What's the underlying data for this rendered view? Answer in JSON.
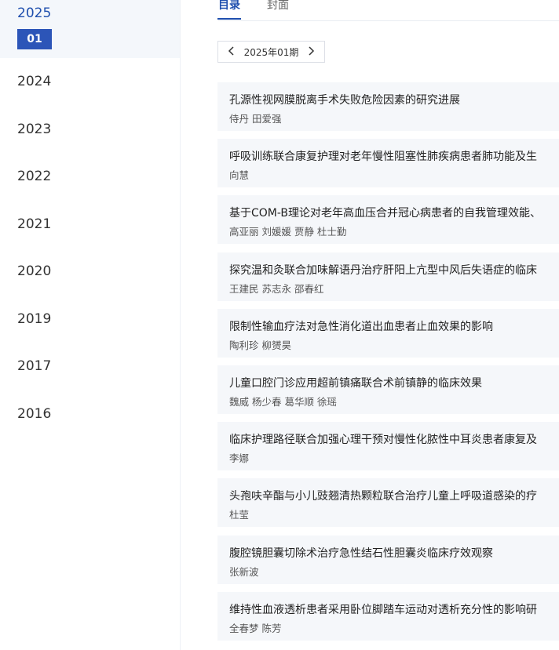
{
  "sidebar": {
    "current_year": "2025",
    "current_month": "01",
    "years": [
      "2024",
      "2023",
      "2022",
      "2021",
      "2020",
      "2019",
      "2017",
      "2016"
    ]
  },
  "tabs": [
    {
      "label": "目录",
      "active": true
    },
    {
      "label": "封面",
      "active": false
    }
  ],
  "issue_selector": {
    "label": "2025年01期",
    "prev_icon": "chevron-left-icon",
    "next_icon": "chevron-right-icon"
  },
  "articles": [
    {
      "title": "孔源性视网膜脱离手术失败危险因素的研究进展",
      "authors": "侍丹 田爱强"
    },
    {
      "title": "呼吸训练联合康复护理对老年慢性阻塞性肺疾病患者肺功能及生",
      "authors": "向慧"
    },
    {
      "title": "基于COM-B理论对老年高血压合并冠心病患者的自我管理效能、",
      "authors": "高亚丽 刘媛媛 贾静 杜士勤"
    },
    {
      "title": "探究温和灸联合加味解语丹治疗肝阳上亢型中风后失语症的临床",
      "authors": "王建民 苏志永 邵春红"
    },
    {
      "title": "限制性输血疗法对急性消化道出血患者止血效果的影响",
      "authors": "陶利珍 柳赟昊"
    },
    {
      "title": "儿童口腔门诊应用超前镇痛联合术前镇静的临床效果",
      "authors": "魏威 杨少春 葛华顺 徐瑶"
    },
    {
      "title": "临床护理路径联合加强心理干预对慢性化脓性中耳炎患者康复及",
      "authors": "李娜"
    },
    {
      "title": "头孢呋辛酯与小儿豉翘清热颗粒联合治疗儿童上呼吸道感染的疗",
      "authors": "杜莹"
    },
    {
      "title": "腹腔镜胆囊切除术治疗急性结石性胆囊炎临床疗效观察",
      "authors": "张新波"
    },
    {
      "title": "维持性血液透析患者采用卧位脚踏车运动对透析充分性的影响研",
      "authors": "全春梦 陈芳"
    }
  ],
  "colors": {
    "accent": "#1f4fae",
    "pill": "#2c55b8",
    "card_bg": "#f5f7fa"
  }
}
